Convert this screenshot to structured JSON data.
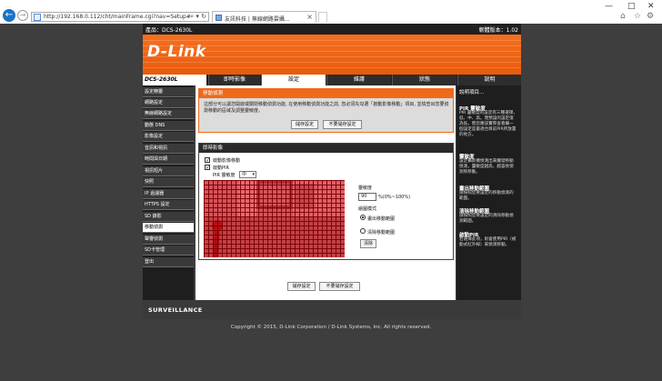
{
  "browser": {
    "url": "http://192.168.0.112/cht/mainFrame.cgi?nav=Setup#",
    "tab_title": "友訊科技 | 無線網路雲攝...",
    "tab_close": "×"
  },
  "topbar": {
    "product_label": "產品：DCS-2630L",
    "firmware_label": "韌體版本：1.02"
  },
  "brand": {
    "logo": "D-Link"
  },
  "model": "DCS-2630L",
  "nav_tabs": [
    {
      "label": "即時影像",
      "active": false
    },
    {
      "label": "設定",
      "active": true
    },
    {
      "label": "維護",
      "active": false
    },
    {
      "label": "狀態",
      "active": false
    },
    {
      "label": "說明",
      "active": false
    }
  ],
  "sidebar": {
    "items": [
      {
        "label": "設定精靈",
        "active": false
      },
      {
        "label": "網路設定",
        "active": false
      },
      {
        "label": "無線網路設定",
        "active": false
      },
      {
        "label": "動態 DNS",
        "active": false
      },
      {
        "label": "影像設定",
        "active": false
      },
      {
        "label": "音訊和視訊",
        "active": false
      },
      {
        "label": "時間與日期",
        "active": false
      },
      {
        "label": "視訊短片",
        "active": false
      },
      {
        "label": "快照",
        "active": false
      },
      {
        "label": "IP 過濾器",
        "active": false
      },
      {
        "label": "HTTPS 設定",
        "active": false
      },
      {
        "label": "SD 錄影",
        "active": false
      },
      {
        "label": "移動偵測",
        "active": true
      },
      {
        "label": "聲響偵測",
        "active": false
      },
      {
        "label": "SD卡管理",
        "active": false
      },
      {
        "label": "登出",
        "active": false
      }
    ]
  },
  "motion": {
    "section_title": "移動偵測",
    "description": "這部分可以讓您開啟或關閉移動偵測功能, 在使用移動偵測功能之前, 您必須先勾選「啟動影像移動」項目, 並檢查出您要偵測移動的區域及調整靈敏度。",
    "save_button": "儲存設定",
    "dont_save_button": "不要儲存設定"
  },
  "live": {
    "section_title": "即時影像",
    "enable_video_motion": "啟動影像移動",
    "enable_pir": "啟動PIR",
    "pir_sensitivity_label": "PIR 靈敏度",
    "pir_sensitivity_value": "中",
    "sensitivity_label": "靈敏度",
    "sensitivity_value": "90",
    "sensitivity_range": "%(0%~100%)",
    "draw_mode_label": "繪圖模式",
    "draw_option": "畫出移動範圍",
    "erase_option": "清除移動範圍",
    "selected_mode": "draw",
    "clear_button": "清除"
  },
  "bottom_buttons": {
    "save": "儲存設定",
    "dont_save": "不要儲存設定"
  },
  "help": {
    "title": "說明項目...",
    "sections": [
      {
        "heading": "PIR 靈敏度",
        "text": "PIR 靈敏度的設定有三種選擇，低、中、高。而預設的設定值為低，而您應該實際查看攝一個設定是最適合目前PIR所放置的地方。"
      },
      {
        "heading": "靈敏度",
        "text": "設定攝影機偵測出來觸發移動偵測，靈敏度越高，越容易偵測到移動。"
      },
      {
        "heading": "畫出移動範圍",
        "text": "請按照您要設定的移動偵測的範圍。"
      },
      {
        "heading": "清除移動範圍",
        "text": "請按照您要設定的清除移動偵測範圍。"
      },
      {
        "heading": "啟動PIR",
        "text": "若選擇此項，則會使用PIR（被動式紅外線）來偵測移動。"
      }
    ]
  },
  "footer": {
    "brand": "SURVEILLANCE",
    "copyright": "Copyright © 2015, D-Link Corporation / D-Link Systems, Inc. All rights reserved."
  },
  "colors": {
    "accent_orange": "#ee6a1a",
    "dark_bg": "#3e3e3e",
    "motion_overlay": "#e6141e"
  }
}
